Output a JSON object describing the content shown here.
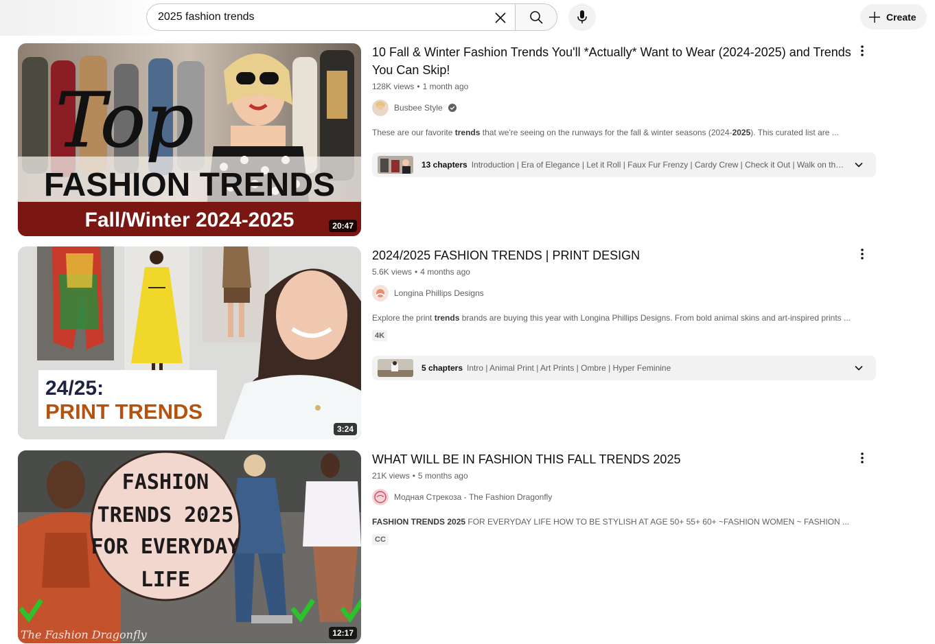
{
  "header": {
    "search_query": "2025 fashion trends",
    "create_label": "Create"
  },
  "results": [
    {
      "title": "10 Fall & Winter Fashion Trends You'll *Actually* Want to Wear (2024-2025) and Trends You Can Skip!",
      "views": "128K views",
      "age": "1 month ago",
      "channel": "Busbee Style",
      "verified": true,
      "description_parts": [
        "These are our favorite ",
        "trends",
        " that we're seeing on the runways for the fall & winter seasons (2024-",
        "2025",
        "). This curated list are ..."
      ],
      "duration": "20:47",
      "thumb_text": {
        "script": "Top",
        "headline": "FASHION TRENDS",
        "banner": "Fall/Winter 2024-2025"
      },
      "chapters": {
        "count": "13 chapters",
        "list": "Introduction | Era of Elegance | Let it Roll | Faux Fur Frenzy | Cardy Crew | Check it Out | Walk on the Wi..."
      }
    },
    {
      "title": "2024/2025 FASHION TRENDS | PRINT DESIGN",
      "views": "5.6K views",
      "age": "4 months ago",
      "channel": "Longina Phillips Designs",
      "verified": false,
      "description_parts": [
        "Explore the print ",
        "trends",
        " brands are buying this year with Longina Phillips Designs. From bold animal skins and art-inspired prints ..."
      ],
      "badge": "4K",
      "duration": "3:24",
      "thumb_text": {
        "line1": "24/25:",
        "line2": "PRINT TRENDS"
      },
      "chapters": {
        "count": "5 chapters",
        "list": "Intro | Animal Print | Art Prints | Ombre | Hyper Feminine"
      }
    },
    {
      "title": "WHAT WILL BE IN FASHION THIS FALL TRENDS 2025",
      "views": "21K views",
      "age": "5 months ago",
      "channel": "Модная Стрекоза - The Fashion Dragonfly",
      "verified": false,
      "description_parts": [
        "FASHION TRENDS 2025",
        " FOR EVERYDAY LIFE HOW TO BE STYLISH AT AGE 50+ 55+ 60+ ~FASHION WOMEN ~ FASHION ..."
      ],
      "badge": "CC",
      "duration": "12:17",
      "thumb_text": {
        "line1": "FASHION",
        "line2": "TRENDS 2025",
        "line3": "FOR EVERYDAY",
        "line4": "LIFE",
        "watermark": "The Fashion Dragonfly"
      }
    }
  ],
  "colors": {
    "accent_banner": "#7a1712",
    "print_trends_orange": "#b5520e",
    "check_green": "#2bc32b",
    "circle_pink": "#f2d7cf"
  }
}
